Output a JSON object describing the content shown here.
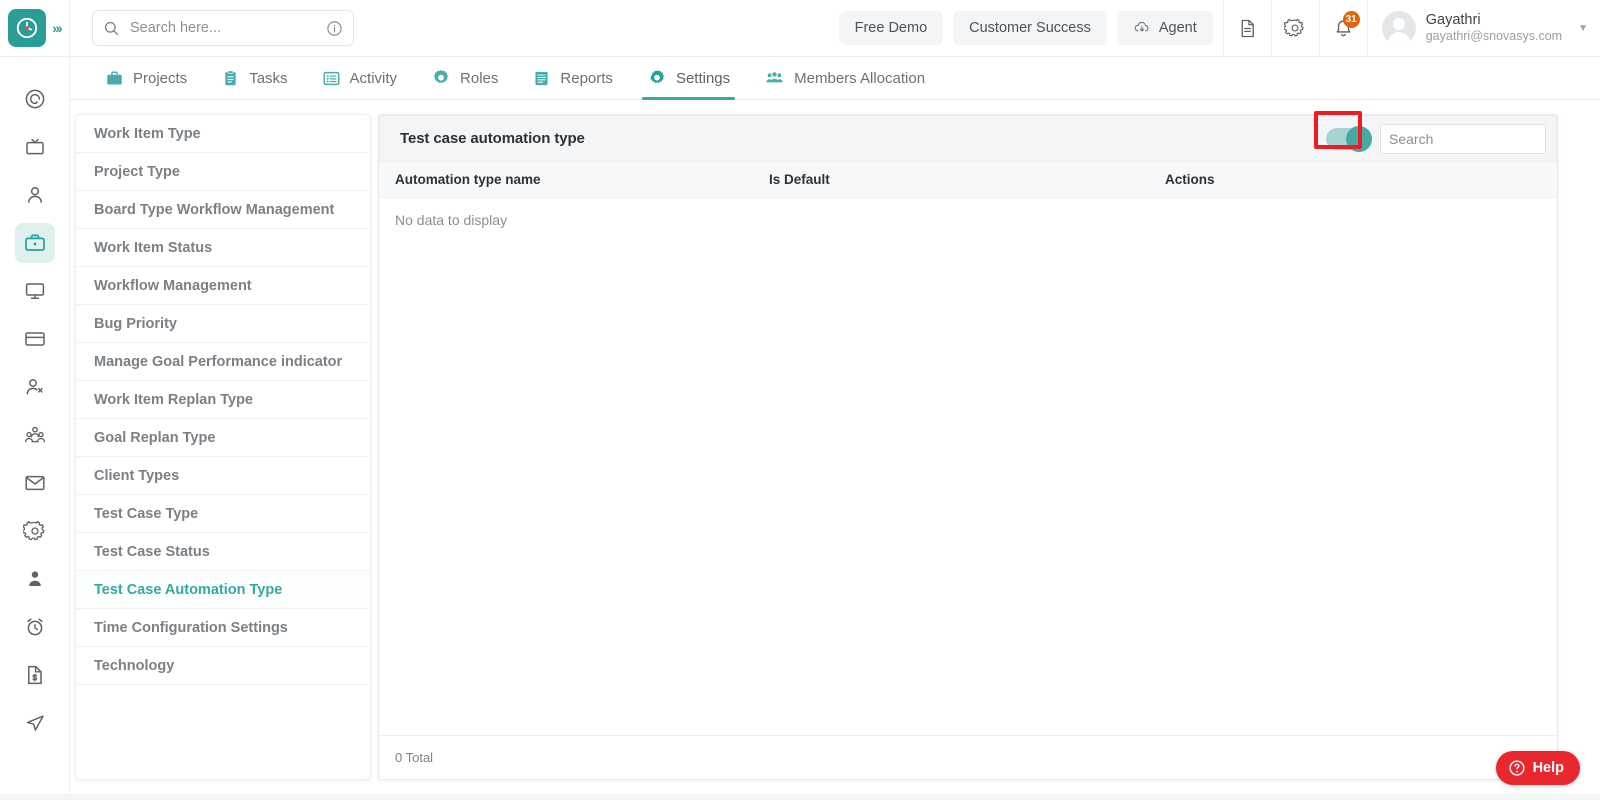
{
  "header": {
    "logo_icon": "clock-logo-icon",
    "expand_icon": "double-chevron-right-icon",
    "search": {
      "icon": "search-icon",
      "placeholder": "Search here...",
      "value": "",
      "info_icon": "info-circle-icon"
    },
    "buttons": [
      {
        "label": "Free Demo",
        "icon": null
      },
      {
        "label": "Customer Success",
        "icon": null
      },
      {
        "label": "Agent",
        "icon": "cloud-download-icon"
      }
    ],
    "icons": [
      {
        "name": "document-icon"
      },
      {
        "name": "gear-icon"
      },
      {
        "name": "bell-icon",
        "badge": "31"
      }
    ],
    "user": {
      "name": "Gayathri",
      "email": "gayathri@snovasys.com",
      "avatar_icon": "user-avatar",
      "caret_icon": "chevron-down-icon"
    }
  },
  "nav": {
    "tabs": [
      {
        "label": "Projects",
        "icon": "briefcase-icon",
        "active": false
      },
      {
        "label": "Tasks",
        "icon": "clipboard-icon",
        "active": false
      },
      {
        "label": "Activity",
        "icon": "list-grid-icon",
        "active": false
      },
      {
        "label": "Roles",
        "icon": "gear-sun-icon",
        "active": false
      },
      {
        "label": "Reports",
        "icon": "report-icon",
        "active": false
      },
      {
        "label": "Settings",
        "icon": "gear-icon",
        "active": true
      },
      {
        "label": "Members Allocation",
        "icon": "people-group-icon",
        "active": false
      }
    ]
  },
  "rail": {
    "items": [
      {
        "icon": "target-spiral-icon",
        "active": false
      },
      {
        "icon": "tv-screen-icon",
        "active": false
      },
      {
        "icon": "person-icon",
        "active": false
      },
      {
        "icon": "briefcase-icon",
        "active": true
      },
      {
        "icon": "monitor-icon",
        "active": false
      },
      {
        "icon": "credit-card-icon",
        "active": false
      },
      {
        "icon": "user-settings-icon",
        "active": false
      },
      {
        "icon": "team-group-icon",
        "active": false
      },
      {
        "icon": "mail-icon",
        "active": false
      },
      {
        "icon": "gear-icon",
        "active": false
      },
      {
        "icon": "user-profile-icon",
        "active": false
      },
      {
        "icon": "alarm-clock-icon",
        "active": false
      },
      {
        "icon": "invoice-icon",
        "active": false
      },
      {
        "icon": "send-paper-plane-icon",
        "active": false
      }
    ]
  },
  "settings_sidebar": {
    "items": [
      {
        "label": "Work Item Type",
        "active": false
      },
      {
        "label": "Project Type",
        "active": false
      },
      {
        "label": "Board Type Workflow Management",
        "active": false
      },
      {
        "label": "Work Item Status",
        "active": false
      },
      {
        "label": "Workflow Management",
        "active": false
      },
      {
        "label": "Bug Priority",
        "active": false
      },
      {
        "label": "Manage Goal Performance indicator",
        "active": false
      },
      {
        "label": "Work Item Replan Type",
        "active": false
      },
      {
        "label": "Goal Replan Type",
        "active": false
      },
      {
        "label": "Client Types",
        "active": false
      },
      {
        "label": "Test Case Type",
        "active": false
      },
      {
        "label": "Test Case Status",
        "active": false
      },
      {
        "label": "Test Case Automation Type",
        "active": true
      },
      {
        "label": "Time Configuration Settings",
        "active": false
      },
      {
        "label": "Technology",
        "active": false
      }
    ]
  },
  "panel": {
    "title": "Test case automation type",
    "toggle": {
      "name": "show-inactive-toggle",
      "state": "on",
      "highlighted": true
    },
    "search": {
      "placeholder": "Search",
      "value": ""
    },
    "table": {
      "columns": [
        "Automation type name",
        "Is Default",
        "Actions"
      ],
      "rows": [],
      "empty_message": "No data to display",
      "footer_total": "0 Total"
    }
  },
  "help": {
    "label": "Help",
    "icon": "question-circle-icon"
  },
  "colors": {
    "brand_teal": "#2a9d98",
    "accent_teal": "#3aa9a3",
    "badge_orange": "#e8620c",
    "help_red": "#e8282e",
    "highlight_red": "#ee1d23"
  }
}
